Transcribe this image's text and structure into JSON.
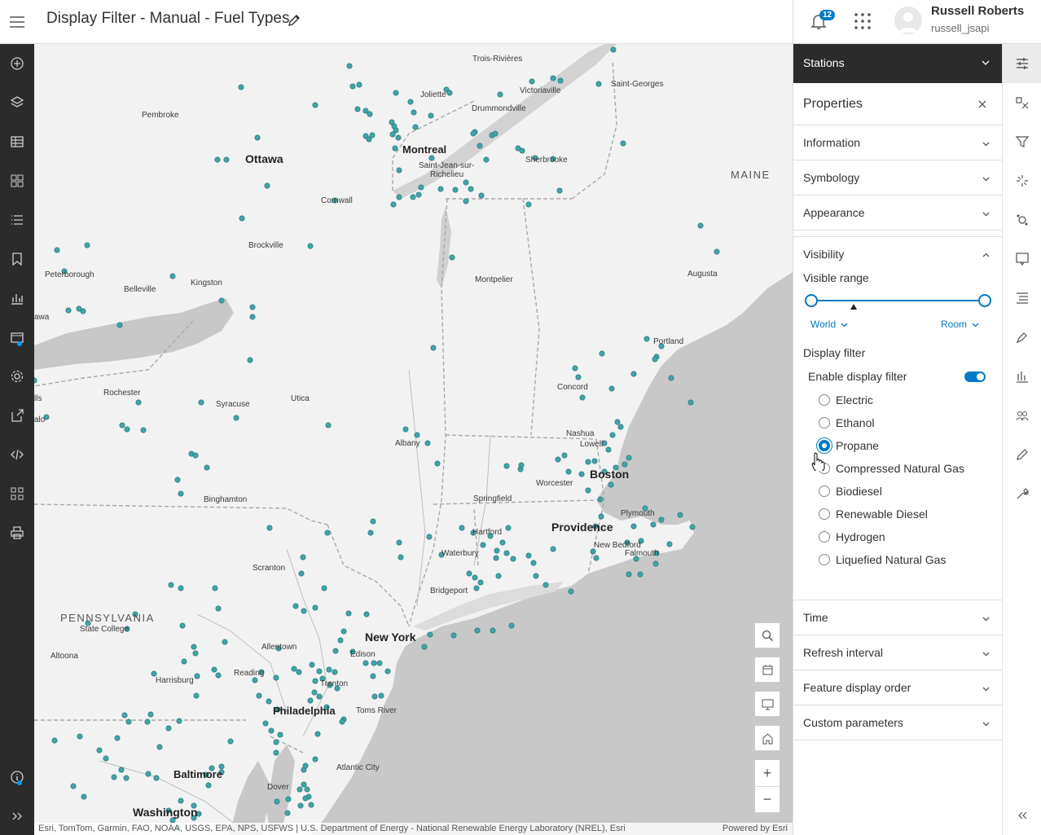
{
  "header": {
    "title": "Display Filter - Manual - Fuel Types",
    "notification_count": "12",
    "user_name": "Russell Roberts",
    "user_id": "russell_jsapi"
  },
  "left_toolbar": [
    "add-icon",
    "layers-icon",
    "table-icon",
    "grid-icon",
    "list-icon",
    "bookmark-icon",
    "chart-icon",
    "data-icon",
    "settings-icon",
    "share-icon",
    "code-icon",
    "widgets-icon",
    "print-icon"
  ],
  "map": {
    "labels": [
      {
        "text": "Trois-Rivières"
      },
      {
        "text": "Joliette"
      },
      {
        "text": "Victoriaville"
      },
      {
        "text": "Saint-Georges"
      },
      {
        "text": "Drummondville"
      },
      {
        "text": "Pembroke"
      },
      {
        "text": "Montreal"
      },
      {
        "text": "Ottawa"
      },
      {
        "text": "Sherbrooke"
      },
      {
        "text": "Saint-Jean-sur-"
      },
      {
        "text": "Richelieu"
      },
      {
        "text": "MAINE"
      },
      {
        "text": "Cornwall"
      },
      {
        "text": "Brockville"
      },
      {
        "text": "Augusta"
      },
      {
        "text": "Peterborough"
      },
      {
        "text": "Kingston"
      },
      {
        "text": "Montpelier"
      },
      {
        "text": "Belleville"
      },
      {
        "text": "awa"
      },
      {
        "text": "Portland"
      },
      {
        "text": "Rochester"
      },
      {
        "text": "Concord"
      },
      {
        "text": "Syracuse"
      },
      {
        "text": "Utica"
      },
      {
        "text": "lls"
      },
      {
        "text": "alo"
      },
      {
        "text": "Nashua"
      },
      {
        "text": "Albany"
      },
      {
        "text": "Lowell"
      },
      {
        "text": "Boston"
      },
      {
        "text": "Worcester"
      },
      {
        "text": "Binghamton"
      },
      {
        "text": "Springfield"
      },
      {
        "text": "Plymouth"
      },
      {
        "text": "Providence"
      },
      {
        "text": "Hartford"
      },
      {
        "text": "New Bedford"
      },
      {
        "text": "Waterbury"
      },
      {
        "text": "Falmouth"
      },
      {
        "text": "Scranton"
      },
      {
        "text": "Bridgeport"
      },
      {
        "text": "PENNSYLVANIA"
      },
      {
        "text": "State College"
      },
      {
        "text": "New York"
      },
      {
        "text": "Allentown"
      },
      {
        "text": "Altoona"
      },
      {
        "text": "Edison"
      },
      {
        "text": "Reading"
      },
      {
        "text": "Trenton"
      },
      {
        "text": "Harrisburg"
      },
      {
        "text": "Philadelphia"
      },
      {
        "text": "Toms River"
      },
      {
        "text": "Atlantic City"
      },
      {
        "text": "Baltimore"
      },
      {
        "text": "Dover"
      },
      {
        "text": "Washington"
      }
    ],
    "attribution": "Esri, TomTom, Garmin, FAO, NOAA, USGS, EPA, NPS, USFWS | U.S. Department of Energy - National Renewable Energy Laboratory (NREL), Esri",
    "powered_by": "Powered by Esri",
    "zoom_in": "+",
    "zoom_out": "−"
  },
  "panel": {
    "layer_name": "Stations",
    "properties_title": "Properties",
    "sections_top": [
      "Information",
      "Symbology",
      "Appearance"
    ],
    "visibility": {
      "title": "Visibility",
      "visible_range_label": "Visible range",
      "min_scale": "World",
      "max_scale": "Room",
      "display_filter_label": "Display filter",
      "enable_label": "Enable display filter",
      "enabled": true,
      "options": [
        "Electric",
        "Ethanol",
        "Propane",
        "Compressed Natural Gas",
        "Biodiesel",
        "Renewable Diesel",
        "Hydrogen",
        "Liquefied Natural Gas"
      ],
      "selected": "Propane"
    },
    "sections_bottom": [
      "Time",
      "Refresh interval",
      "Feature display order",
      "Custom parameters"
    ]
  },
  "right_rail": [
    "properties-icon",
    "styles-icon",
    "filter-icon",
    "effects-icon",
    "aggregation-icon",
    "popups-icon",
    "fields-icon",
    "labels-icon",
    "charts-icon",
    "forms-icon",
    "edit-icon",
    "configure-icon"
  ],
  "colors": {
    "accent": "#007ac2",
    "dark_bar": "#2b2b2b",
    "map_water": "#c8c8c8",
    "map_land": "#f2f2f2",
    "point": "#3fa5a8"
  }
}
